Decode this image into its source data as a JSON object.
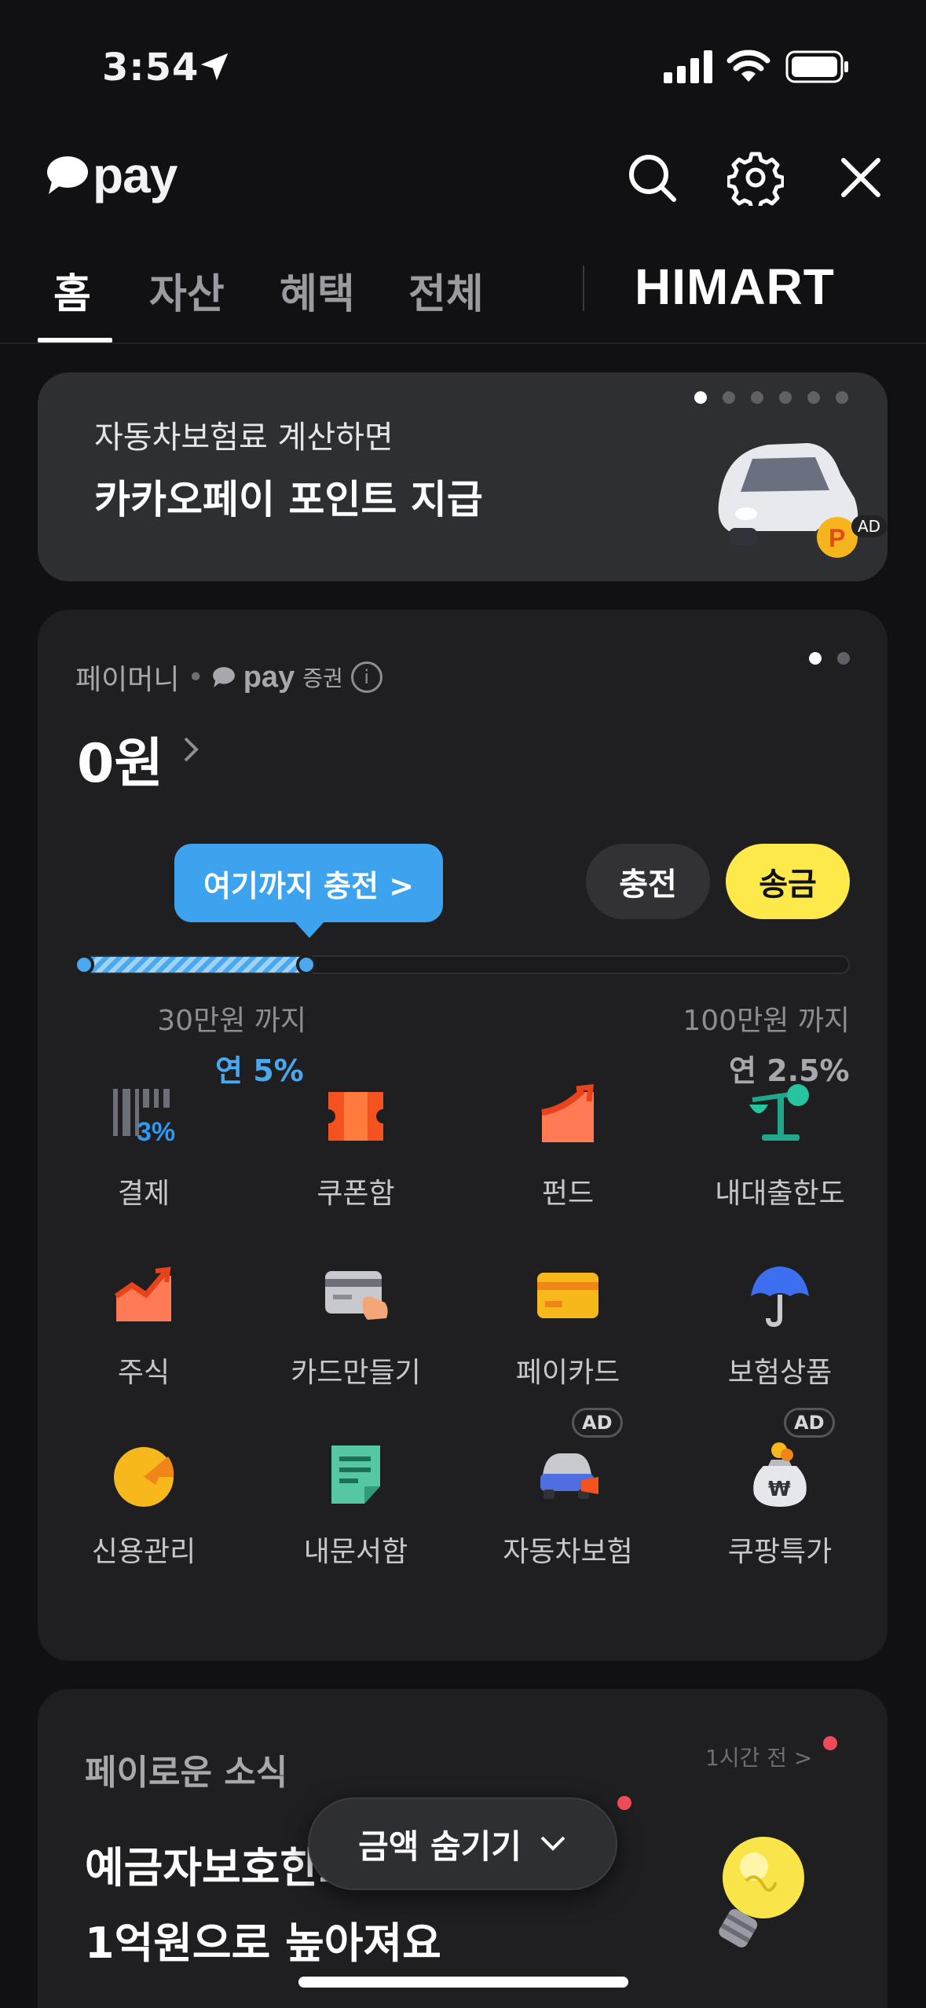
{
  "status_bar": {
    "time": "3:54"
  },
  "header": {
    "logo_text": "pay"
  },
  "tabs": [
    {
      "label": "홈",
      "active": true
    },
    {
      "label": "자산",
      "active": false
    },
    {
      "label": "혜택",
      "active": false
    },
    {
      "label": "전체",
      "active": false
    }
  ],
  "partner_logo": "HIMART",
  "banner": {
    "subtitle": "자동차보험료 계산하면",
    "title": "카카오페이 포인트 지급",
    "ad_label": "AD",
    "coin_label": "P",
    "page_count": 6,
    "active_page": 1
  },
  "money": {
    "label": "페이머니",
    "provider_logo": "pay",
    "provider_suffix": "증권",
    "info_icon": "i",
    "balance": "0원",
    "tooltip": "여기까지 충전  >",
    "charge_label": "충전",
    "send_label": "송금",
    "progress_fraction": 0.3,
    "tier1_label": "30만원 까지",
    "tier1_rate": "연 5%",
    "tier2_label": "100만원 까지",
    "tier2_rate": "연 2.5%",
    "page_count": 2,
    "active_page": 1
  },
  "services": [
    {
      "label": "결제",
      "icon": "barcode-3percent-icon",
      "ad": false
    },
    {
      "label": "쿠폰함",
      "icon": "coupon-ticket-icon",
      "ad": false
    },
    {
      "label": "펀드",
      "icon": "fund-chart-icon",
      "ad": false
    },
    {
      "label": "내대출한도",
      "icon": "scale-icon",
      "ad": false
    },
    {
      "label": "주식",
      "icon": "stock-chart-icon",
      "ad": false
    },
    {
      "label": "카드만들기",
      "icon": "card-make-icon",
      "ad": false
    },
    {
      "label": "페이카드",
      "icon": "pay-card-icon",
      "ad": false
    },
    {
      "label": "보험상품",
      "icon": "umbrella-icon",
      "ad": false
    },
    {
      "label": "신용관리",
      "icon": "credit-gauge-icon",
      "ad": false
    },
    {
      "label": "내문서함",
      "icon": "document-icon",
      "ad": false
    },
    {
      "label": "자동차보험",
      "icon": "car-insurance-icon",
      "ad": true
    },
    {
      "label": "쿠팡특가",
      "icon": "money-bag-icon",
      "ad": true
    }
  ],
  "ad_pill_label": "AD",
  "news": {
    "title": "페이로운 소식",
    "time": "1시간 전  >",
    "headline_line1": "예금자보호한도",
    "headline_line2": "1억원으로 높아져요"
  },
  "floating_button": {
    "label": "금액 숨기기"
  },
  "colors": {
    "background": "#111113",
    "card": "#1f1f22",
    "accent_blue": "#4aa8ef",
    "send_yellow": "#fde94a",
    "notification_red": "#f04a58"
  }
}
